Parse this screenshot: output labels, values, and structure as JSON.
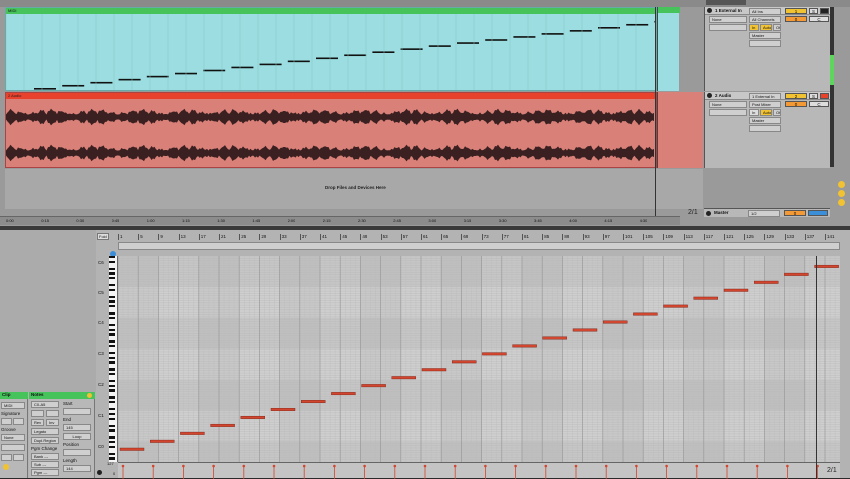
{
  "tracks": {
    "midi": {
      "clip_label": "MIDI",
      "name": "1 External In",
      "input": "All Ins",
      "channel": "All Channels",
      "monitor_in": "In",
      "monitor_auto": "Auto",
      "monitor_off": "Off",
      "output": "Master",
      "preset": "None",
      "number": "1",
      "solo": "S",
      "dot": "0",
      "clip_color": "#9bdde0",
      "header_color": "#46c35a"
    },
    "audio": {
      "clip_label": "2 Audio",
      "name": "2 Audio",
      "input": "1 External In",
      "channel": "Post Mixer",
      "monitor_in": "In",
      "monitor_auto": "Auto",
      "monitor_off": "Off",
      "output": "Master",
      "preset": "None",
      "number": "2",
      "solo": "S",
      "dot": "0",
      "clip_color": "#d98079",
      "header_color": "#e8412c"
    },
    "drop_text": "Drop Files and Devices Here",
    "master": {
      "name": "Master",
      "value": "1/2",
      "dot": "0"
    },
    "fraction": "2/1"
  },
  "arrangement_ruler": [
    "0:00",
    "0:15",
    "0:30",
    "0:45",
    "1:00",
    "1:15",
    "1:30",
    "1:45",
    "2:00",
    "2:15",
    "2:30",
    "2:45",
    "3:00",
    "3:15",
    "3:30",
    "3:45",
    "4:00",
    "4:15",
    "4:30"
  ],
  "midi_editor": {
    "fold_label": "Fold",
    "ruler": [
      "1",
      "5",
      "9",
      "13",
      "17",
      "21",
      "25",
      "29",
      "33",
      "37",
      "41",
      "45",
      "49",
      "53",
      "57",
      "61",
      "65",
      "69",
      "73",
      "77",
      "81",
      "85",
      "89",
      "93",
      "97",
      "101",
      "105",
      "109",
      "113",
      "117",
      "121",
      "125",
      "129",
      "133",
      "137",
      "141"
    ],
    "octaves": [
      "C6",
      "C5",
      "C4",
      "C3",
      "C2",
      "C1",
      "C0"
    ],
    "velocity_max": "127",
    "velocity_min": "0",
    "fraction": "2/1",
    "note_color": "#d2452e"
  },
  "clip_panel": {
    "clip_title": "Clip",
    "clip_name": "MIDI",
    "signature_label": "Signature",
    "groove_label": "Groove",
    "groove_value": "None",
    "notes_title": "Notes",
    "range": "C0-A5",
    "start_label": "Start",
    "end_label": "End",
    "end_value": "145",
    "loop_label": "Loop",
    "rev_label": "Rev",
    "inv_label": "Inv",
    "legato_label": "Legato",
    "dupl_label": "Dupl.Region",
    "pgm_label": "Pgm Change",
    "bank_label": "Bank ---",
    "sub_label": "Sub ---",
    "pgm_value": "Pgm ---",
    "position_label": "Position",
    "length_label": "Length",
    "length_value": "144",
    "zero": "0"
  }
}
